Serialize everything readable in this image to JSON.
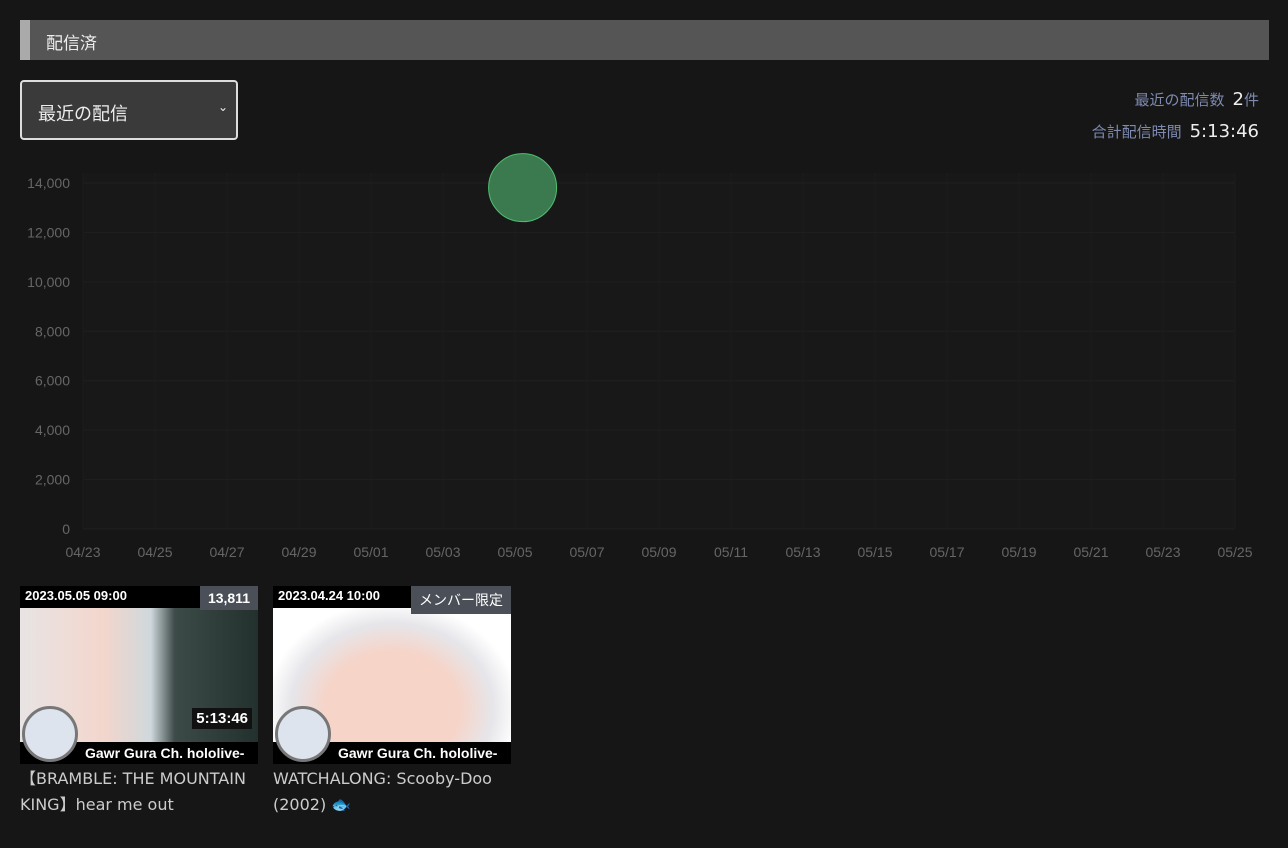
{
  "section_title": "配信済",
  "filter": {
    "selected": "最近の配信"
  },
  "stats": {
    "count_label": "最近の配信数",
    "count": "2",
    "count_unit": "件",
    "total_label": "合計配信時間",
    "total": "5:13:46"
  },
  "chart_data": {
    "type": "scatter",
    "x_ticks": [
      "04/23",
      "04/25",
      "04/27",
      "04/29",
      "05/01",
      "05/03",
      "05/05",
      "05/07",
      "05/09",
      "05/11",
      "05/13",
      "05/15",
      "05/17",
      "05/19",
      "05/21",
      "05/23",
      "05/25"
    ],
    "y_ticks": [
      "0",
      "2,000",
      "4,000",
      "6,000",
      "8,000",
      "10,000",
      "12,000",
      "14,000"
    ],
    "ylim": [
      0,
      14000
    ],
    "xlim_days": [
      0,
      32
    ],
    "points": [
      {
        "day": 12.1,
        "value": 13811
      }
    ],
    "point_color": "#3a7a4e",
    "grid": true
  },
  "videos": [
    {
      "date": "2023.05.05 09:00",
      "badge": "13,811",
      "duration": "5:13:46",
      "channel": "Gawr Gura Ch. hololive-",
      "title": "【BRAMBLE: THE MOUNTAIN KING】hear me out"
    },
    {
      "date": "2023.04.24 10:00",
      "badge": "メンバー限定",
      "channel": "Gawr Gura Ch. hololive-",
      "title": "WATCHALONG: Scooby-Doo (2002) 🐟"
    }
  ]
}
